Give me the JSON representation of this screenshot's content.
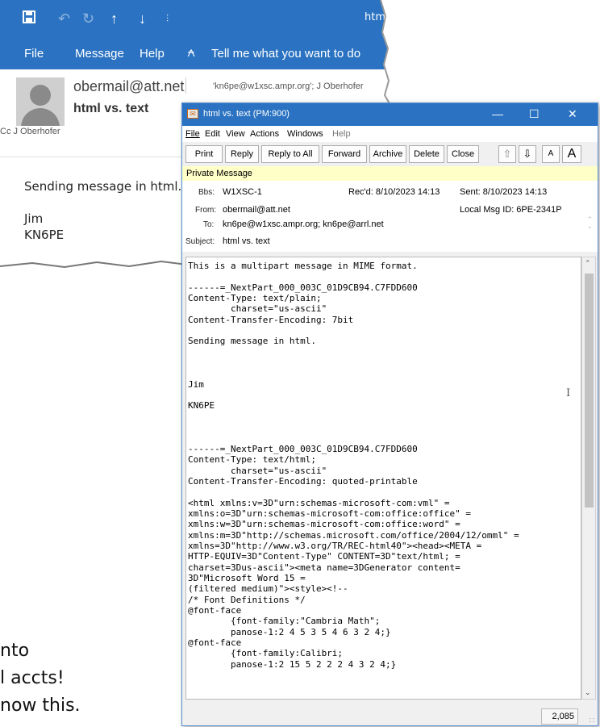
{
  "outlook": {
    "title": "html",
    "ribbon": {
      "file": "File",
      "message": "Message",
      "help": "Help",
      "tell": "Tell me what you want to do"
    },
    "from": "obermail@att.net",
    "to": "'kn6pe@w1xsc.ampr.org'; J Oberhofer",
    "subject": "html vs. text",
    "cc": "Cc   J Oberhofer",
    "body": [
      "Sending message in html.",
      "",
      "Jim",
      "KN6PE"
    ]
  },
  "caption": {
    "line1": "nto",
    "line2": "l accts!",
    "line3": "now this."
  },
  "pm": {
    "title": "html vs. text  (PM:900)",
    "menu": {
      "file": "File",
      "edit": "Edit",
      "view": "View",
      "actions": "Actions",
      "windows": "Windows",
      "help": "Help"
    },
    "toolbar": {
      "print": "Print",
      "reply": "Reply",
      "reply_all": "Reply to All",
      "forward": "Forward",
      "archive": "Archive",
      "delete": "Delete",
      "close": "Close",
      "font_small": "A",
      "font_large": "A"
    },
    "private": "Private Message",
    "header": {
      "bbs_label": "Bbs:",
      "bbs": "W1XSC-1",
      "recd": "Rec'd:  8/10/2023 14:13",
      "sent": "Sent:  8/10/2023 14:13",
      "from_label": "From:",
      "from": "obermail@att.net",
      "local_id": "Local Msg ID:  6PE-2341P",
      "to_label": "To:",
      "to": "kn6pe@w1xsc.ampr.org; kn6pe@arrl.net",
      "subject_label": "Subject:",
      "subject": "html vs. text"
    },
    "body_lines": [
      "This is a multipart message in MIME format.",
      "",
      "------=_NextPart_000_003C_01D9CB94.C7FDD600",
      "Content-Type: text/plain;",
      "        charset=\"us-ascii\"",
      "Content-Transfer-Encoding: 7bit",
      "",
      "Sending message in html.",
      "",
      "",
      "",
      "Jim",
      "",
      "KN6PE",
      "",
      "",
      "",
      "------=_NextPart_000_003C_01D9CB94.C7FDD600",
      "Content-Type: text/html;",
      "        charset=\"us-ascii\"",
      "Content-Transfer-Encoding: quoted-printable",
      "",
      "<html xmlns:v=3D\"urn:schemas-microsoft-com:vml\" =",
      "xmlns:o=3D\"urn:schemas-microsoft-com:office:office\" =",
      "xmlns:w=3D\"urn:schemas-microsoft-com:office:word\" =",
      "xmlns:m=3D\"http://schemas.microsoft.com/office/2004/12/omml\" =",
      "xmlns=3D\"http://www.w3.org/TR/REC-html40\"><head><META =",
      "HTTP-EQUIV=3D\"Content-Type\" CONTENT=3D\"text/html; =",
      "charset=3Dus-ascii\"><meta name=3DGenerator content=",
      "3D\"Microsoft Word 15 =",
      "(filtered medium)\"><style><!--",
      "/* Font Definitions */",
      "@font-face",
      "        {font-family:\"Cambria Math\";",
      "        panose-1:2 4 5 3 5 4 6 3 2 4;}",
      "@font-face",
      "        {font-family:Calibri;",
      "        panose-1:2 15 5 2 2 2 4 3 2 4;}"
    ],
    "char_count": "2,085"
  }
}
